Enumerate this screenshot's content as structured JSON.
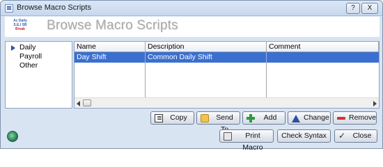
{
  "window": {
    "title": "Browse Macro Scripts",
    "help_label": "?",
    "close_label": "X"
  },
  "header": {
    "title": "Browse Macro Scripts",
    "logo_lines": [
      "Ac Daily",
      "S.E.I SB",
      "Break"
    ]
  },
  "categories": [
    {
      "label": "Daily",
      "selected": true
    },
    {
      "label": "Payroll",
      "selected": false
    },
    {
      "label": "Other",
      "selected": false
    }
  ],
  "grid": {
    "columns": [
      "Name",
      "Description",
      "Comment"
    ],
    "rows": [
      {
        "name": "Day Shift",
        "description": "Common Daily Shift",
        "comment": ""
      }
    ]
  },
  "row_buttons": {
    "copy": "Copy",
    "send_to": "Send To",
    "add": "Add",
    "change": "Change",
    "remove": "Remove"
  },
  "bottom_buttons": {
    "print_macro": "Print Macro",
    "check_syntax": "Check Syntax",
    "close": "Close"
  },
  "colors": {
    "selection": "#3b6fcf",
    "window_bg": "#d9e4f2",
    "header_title": "#a9a9a9"
  }
}
